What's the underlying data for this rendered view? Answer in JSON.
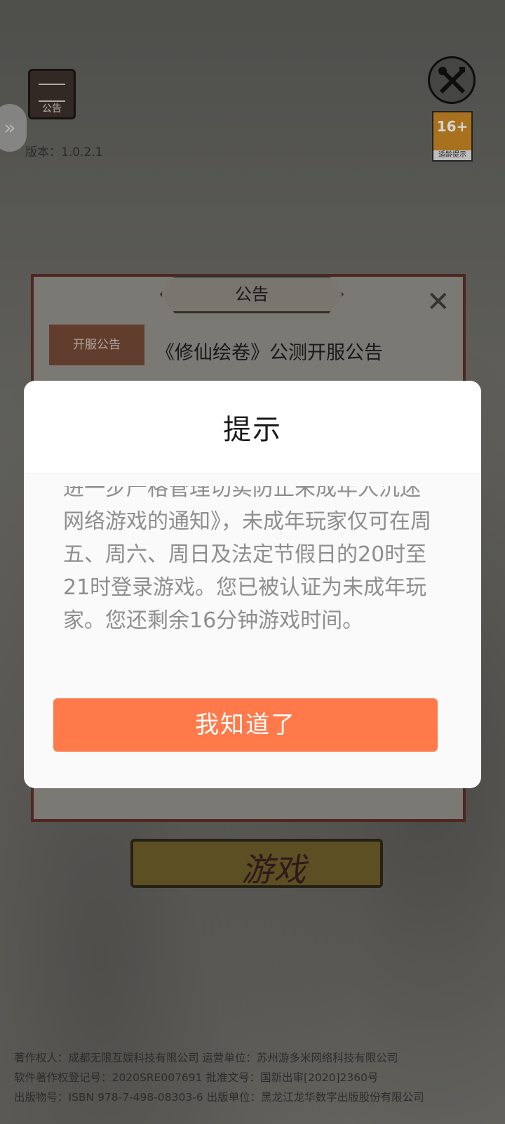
{
  "top_left": {
    "notice_label": "公告",
    "version": "版本：1.0.2.1"
  },
  "age_rating": {
    "number": "16+",
    "caption": "适龄提示"
  },
  "announcement_panel": {
    "tab_title": "公告",
    "side_tab": "开服公告",
    "headline": "《修仙绘卷》公测开服公告"
  },
  "dialog": {
    "title": "提示",
    "message": "进一步严格管理切实防止未成年人沉迷网络游戏的通知》，未成年玩家仅可在周五、周六、周日及法定节假日的20时至21时登录游戏。您已被认证为未成年玩家。您还剩余16分钟游戏时间。",
    "button": "我知道了"
  },
  "background_text": {
    "start_button": "游戏"
  },
  "footer": {
    "line1": "著作权人：成都无限互娱科技有限公司  运营单位：苏州游多米网络科技有限公司",
    "line2": "软件著作权登记号：2020SRE007691  批准文号：国新出审[2020]2360号",
    "line3": "出版物号：ISBN 978-7-498-08303-6  出版单位：黑龙江龙华数字出版股份有限公司"
  },
  "colors": {
    "accent_button": "#ff7a4a",
    "dialog_bg": "#fafafa",
    "message_text": "#8e8e8e"
  }
}
